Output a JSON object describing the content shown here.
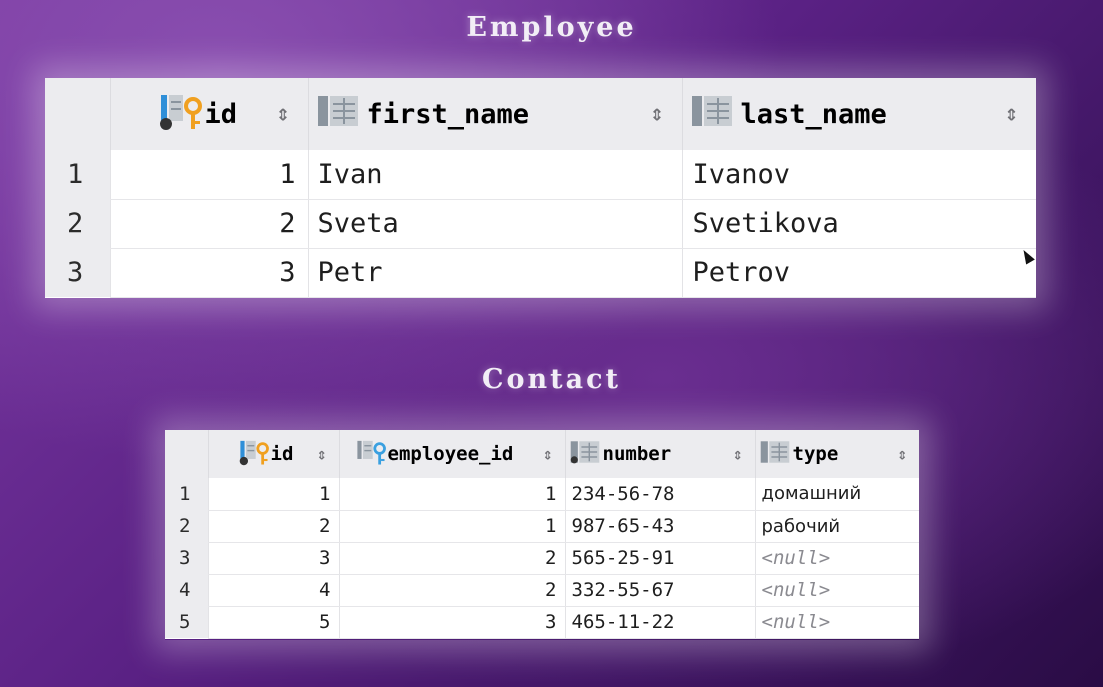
{
  "employee": {
    "title": "Employee",
    "columns": [
      {
        "name": "id",
        "icon": "primary-key-icon"
      },
      {
        "name": "first_name",
        "icon": "column-icon"
      },
      {
        "name": "last_name",
        "icon": "column-icon"
      }
    ],
    "rows": [
      {
        "n": "1",
        "id": "1",
        "first_name": "Ivan",
        "last_name": "Ivanov"
      },
      {
        "n": "2",
        "id": "2",
        "first_name": "Sveta",
        "last_name": "Svetikova"
      },
      {
        "n": "3",
        "id": "3",
        "first_name": "Petr",
        "last_name": "Petrov"
      }
    ]
  },
  "contact": {
    "title": "Contact",
    "columns": [
      {
        "name": "id",
        "icon": "primary-key-icon"
      },
      {
        "name": "employee_id",
        "icon": "foreign-key-icon"
      },
      {
        "name": "number",
        "icon": "column-icon"
      },
      {
        "name": "type",
        "icon": "column-icon"
      }
    ],
    "rows": [
      {
        "n": "1",
        "id": "1",
        "employee_id": "1",
        "number": "234-56-78",
        "type": "домашний"
      },
      {
        "n": "2",
        "id": "2",
        "employee_id": "1",
        "number": "987-65-43",
        "type": "рабочий"
      },
      {
        "n": "3",
        "id": "3",
        "employee_id": "2",
        "number": "565-25-91",
        "type": "<null>"
      },
      {
        "n": "4",
        "id": "4",
        "employee_id": "2",
        "number": "332-55-67",
        "type": "<null>"
      },
      {
        "n": "5",
        "id": "5",
        "employee_id": "3",
        "number": "465-11-22",
        "type": "<null>"
      }
    ]
  },
  "colors": {
    "pk_key": "#f0a020",
    "fk_key": "#3aa0e0",
    "table_icon": "#8a949e",
    "accent_bar": "#2f8fd8"
  }
}
